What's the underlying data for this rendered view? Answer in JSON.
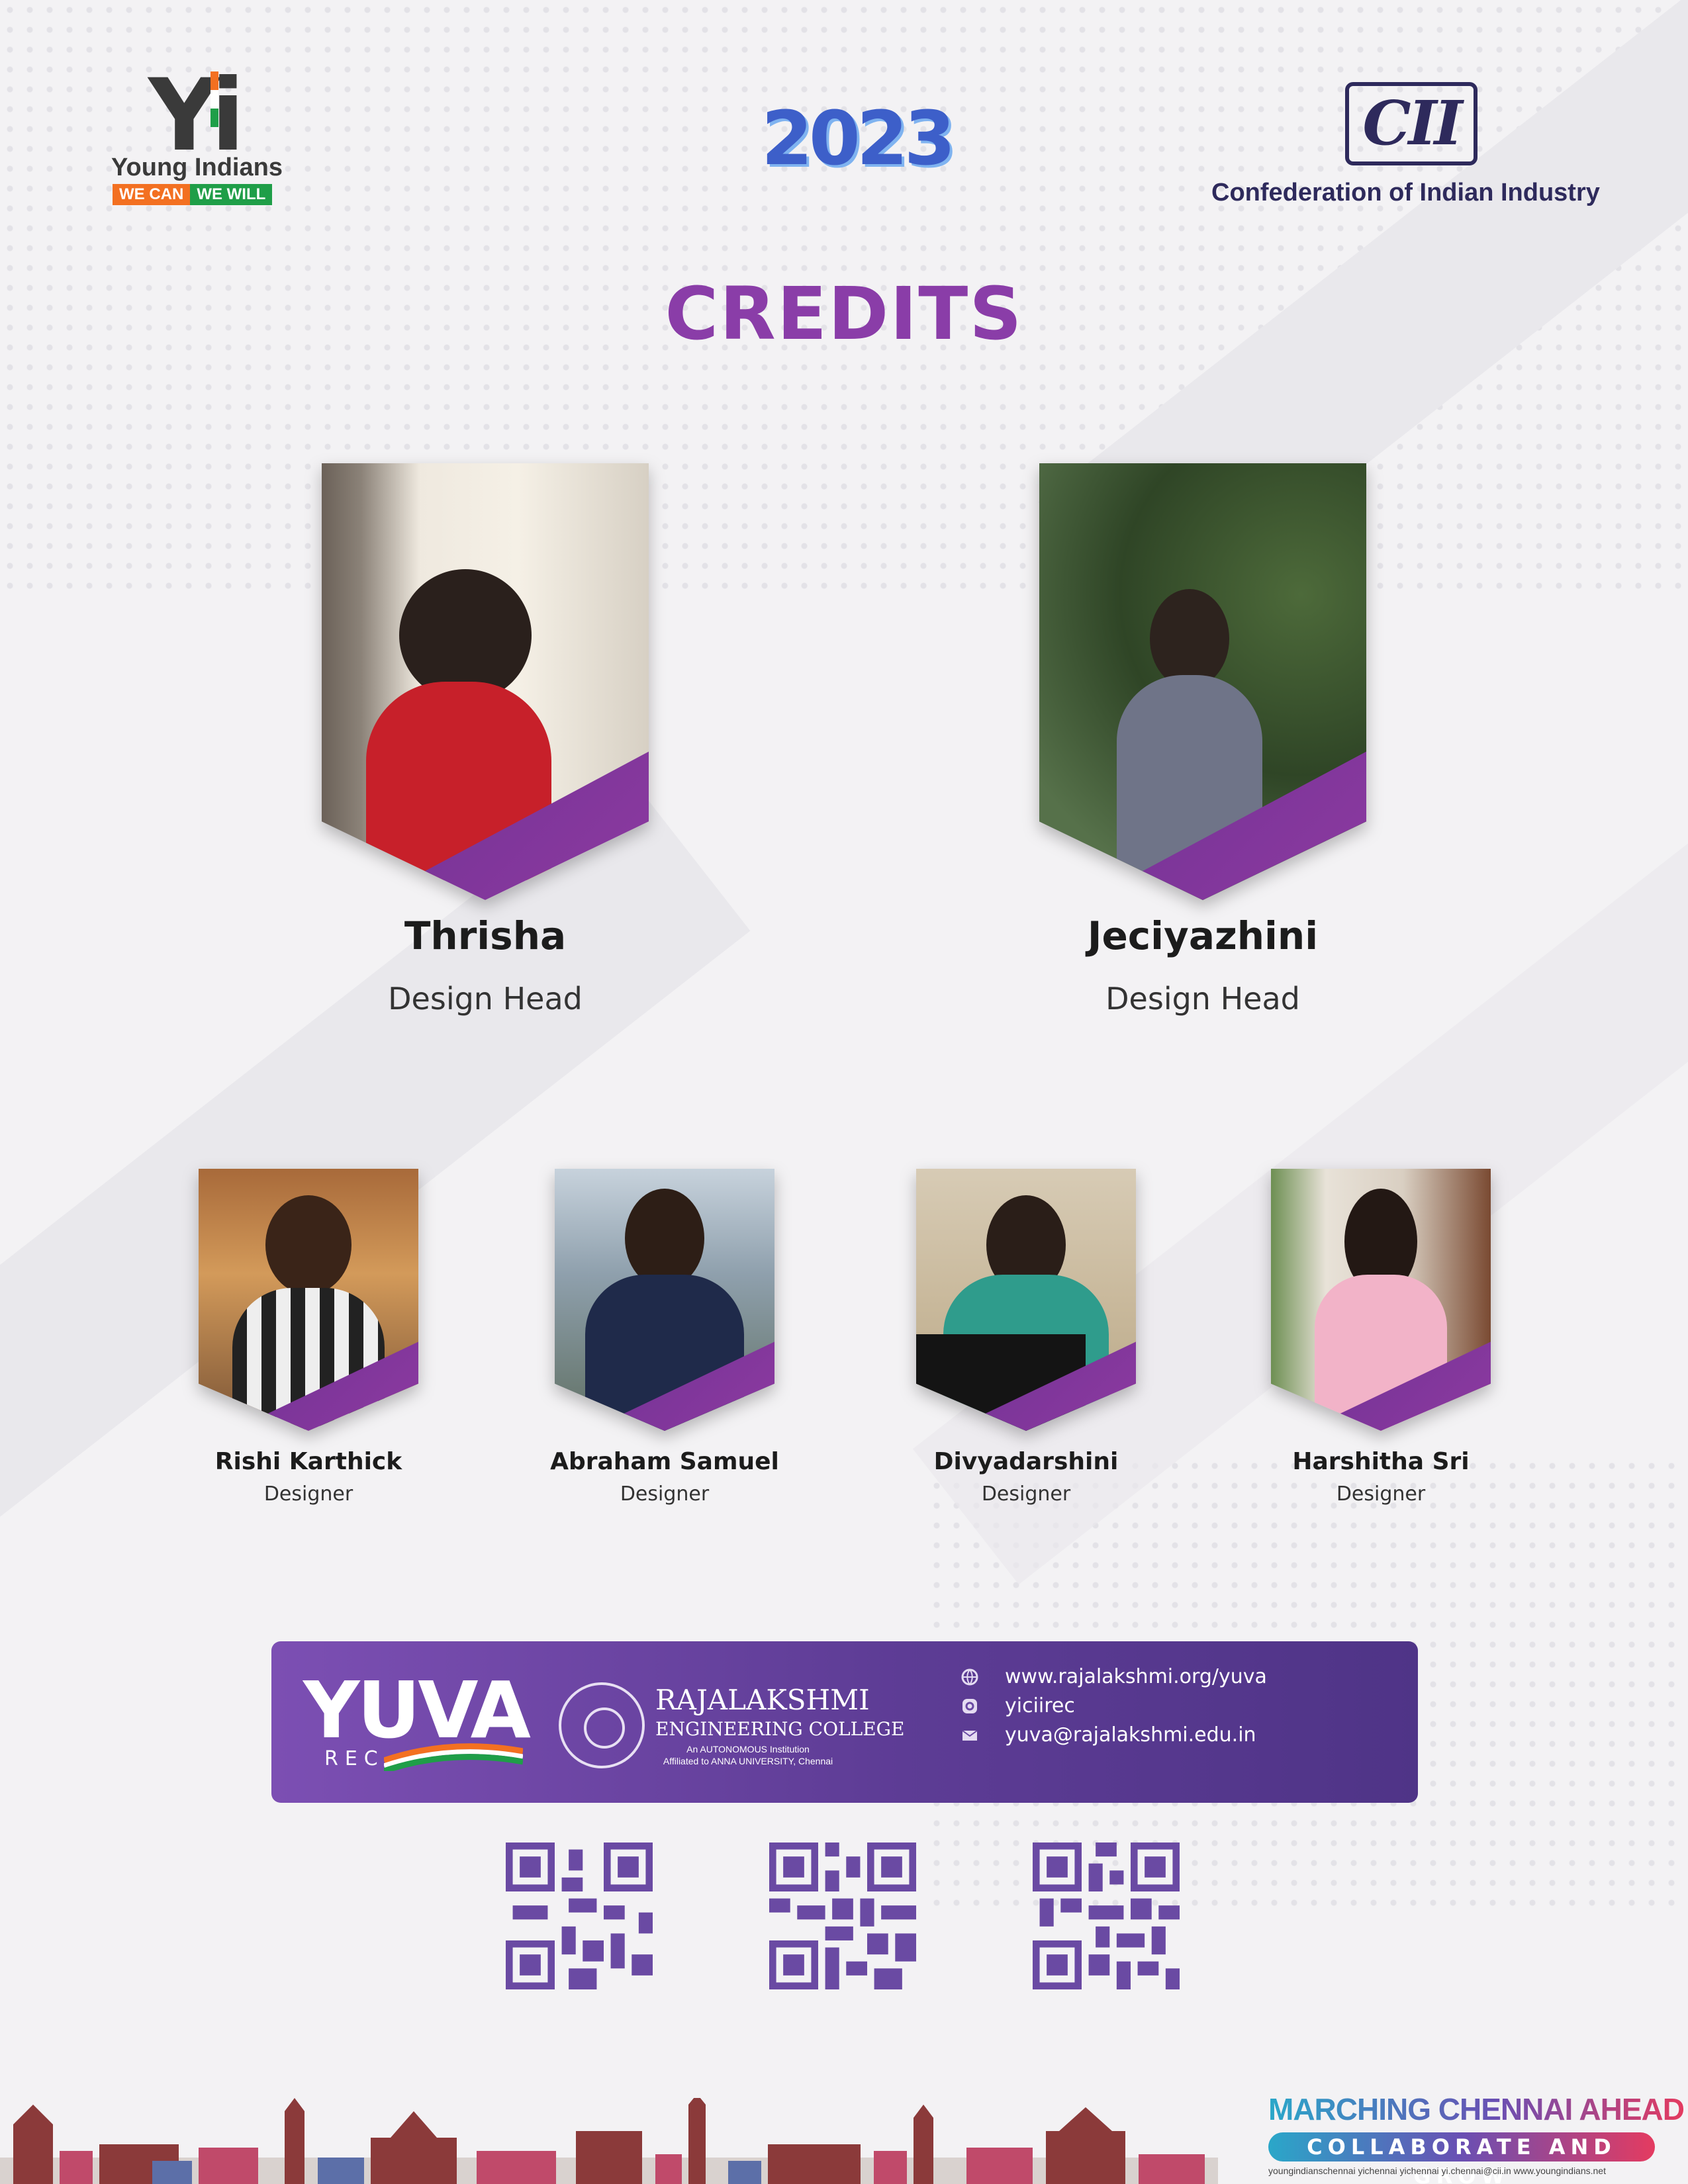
{
  "header": {
    "yi_logo": {
      "mark": "Yi",
      "name": "Young Indians",
      "tag_left": "WE CAN",
      "tag_right": "WE WILL"
    },
    "year": "2023",
    "cii_logo": {
      "mark": "CII",
      "name": "Confederation of Indian Industry"
    }
  },
  "title": "CREDITS",
  "heads": [
    {
      "name": "Thrisha",
      "role": "Design Head"
    },
    {
      "name": "Jeciyazhini",
      "role": "Design Head"
    }
  ],
  "designers": [
    {
      "name": "Rishi Karthick",
      "role": "Designer"
    },
    {
      "name": "Abraham Samuel",
      "role": "Designer"
    },
    {
      "name": "Divyadarshini",
      "role": "Designer"
    },
    {
      "name": "Harshitha Sri",
      "role": "Designer"
    }
  ],
  "banner": {
    "yuva": "YUVA",
    "yuva_sub": "REC",
    "college_name": "RAJALAKSHMI",
    "college_sub": "ENGINEERING COLLEGE",
    "college_line1": "An AUTONOMOUS Institution",
    "college_line2": "Affiliated to ANNA UNIVERSITY, Chennai",
    "website": "www.rajalakshmi.org/yuva",
    "instagram": "yiciirec",
    "email": "yuva@rajalakshmi.edu.in",
    "icons": [
      "globe-icon",
      "instagram-icon",
      "mail-icon"
    ]
  },
  "footer": {
    "marching": "MARCHING CHENNAI AHEAD",
    "collaborate": "COLLABORATE AND GROW",
    "socials": "youngindianschennai   yichennai   yichennai   yi.chennai@cii.in   www.youngindians.net"
  },
  "colors": {
    "accent_purple": "#8a3da8",
    "banner_purple": "#5d3c95",
    "year_blue": "#3d5fc9"
  }
}
